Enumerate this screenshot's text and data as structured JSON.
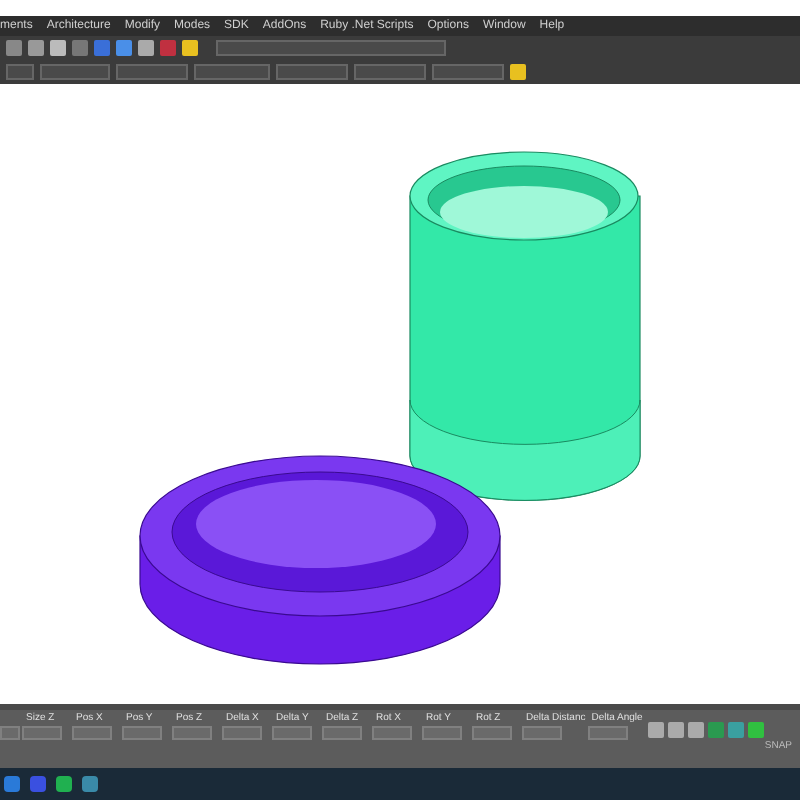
{
  "menu_bar": {
    "items": [
      "ments",
      "Architecture",
      "Modify",
      "Modes",
      "SDK",
      "AddOns",
      "Ruby .Net Scripts",
      "Options",
      "Window",
      "Help"
    ]
  },
  "viewport": {
    "objects": [
      {
        "kind": "cylinder",
        "color": "#33e8a8"
      },
      {
        "kind": "cap",
        "color": "#6a1ee8"
      }
    ]
  },
  "coordinate_panel": {
    "fields": [
      "Size Z",
      "Pos X",
      "Pos Y",
      "Pos Z",
      "Delta X",
      "Delta Y",
      "Delta Z",
      "Rot X",
      "Rot Y",
      "Rot Z",
      "Delta Distanc",
      "Delta Angle"
    ]
  },
  "status_bar": {
    "text": "SNAP"
  }
}
